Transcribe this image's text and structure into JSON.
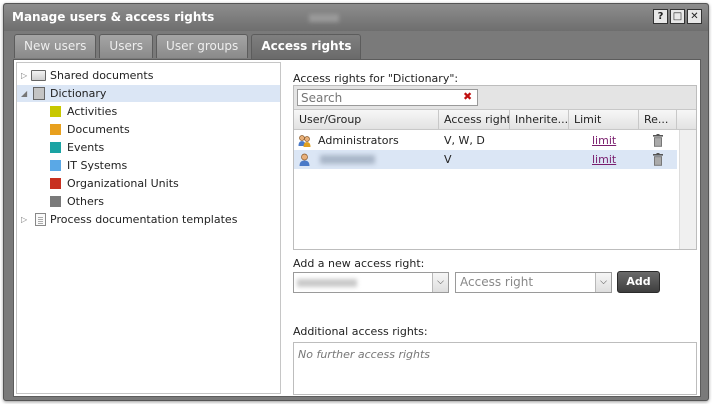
{
  "window": {
    "title": "Manage users & access rights",
    "buttons": [
      "?",
      "□",
      "✕"
    ]
  },
  "tabs": [
    {
      "label": "New users",
      "active": false
    },
    {
      "label": "Users",
      "active": false
    },
    {
      "label": "User groups",
      "active": false
    },
    {
      "label": "Access rights",
      "active": true
    }
  ],
  "tree": {
    "items": [
      {
        "label": "Shared documents",
        "icon": "folder-icon",
        "expander": "▷"
      },
      {
        "label": "Dictionary",
        "icon": "dictionary-icon",
        "expander": "◢",
        "selected": true
      },
      {
        "label": "Activities",
        "color": "#c8c800"
      },
      {
        "label": "Documents",
        "color": "#e8a01e"
      },
      {
        "label": "Events",
        "color": "#1aa3a3"
      },
      {
        "label": "IT Systems",
        "color": "#5aa8e6"
      },
      {
        "label": "Organizational Units",
        "color": "#c83020"
      },
      {
        "label": "Others",
        "color": "#7a7a7a"
      },
      {
        "label": "Process documentation templates",
        "icon": "document-icon",
        "expander": "▷"
      }
    ]
  },
  "access": {
    "heading": "Access rights for \"Dictionary\":",
    "search_placeholder": "Search",
    "clear_icon": "✖",
    "columns": [
      "User/Group",
      "Access right",
      "Inherite...",
      "Limit",
      "Re..."
    ],
    "rows": [
      {
        "name": "Administrators",
        "rights": "V, W, D",
        "inherited": "",
        "limit": "limit"
      },
      {
        "name": "",
        "rights": "V",
        "inherited": "",
        "limit": "limit",
        "selected": true
      }
    ]
  },
  "add": {
    "label": "Add a new access right:",
    "user_select_value": "",
    "right_select_placeholder": "Access right",
    "dropdown_arrow": "⌵",
    "button": "Add"
  },
  "additional": {
    "label": "Additional access rights:",
    "empty_text": "No further access rights"
  },
  "colors": {
    "titlebar": "#7a7a7a",
    "selected_row": "#dbe6f5",
    "link": "#7a1e6e"
  }
}
